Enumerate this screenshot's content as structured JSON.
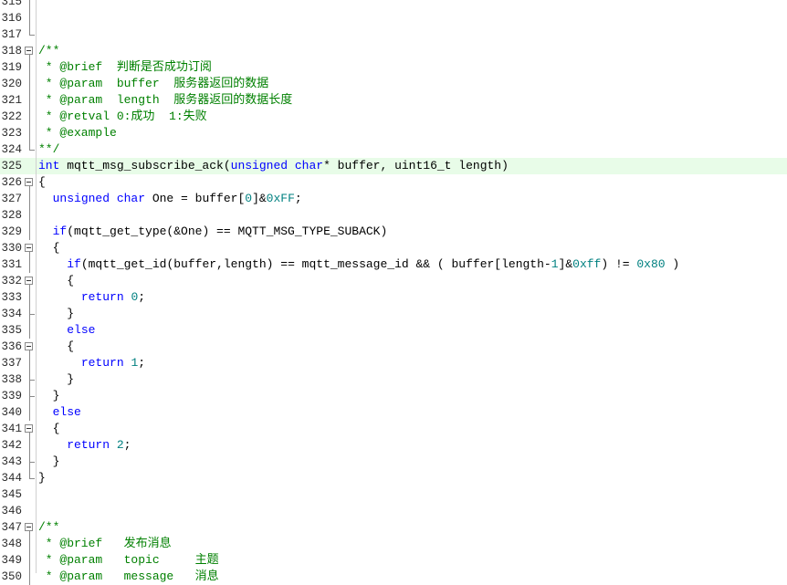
{
  "editor": {
    "highlight_line": "325",
    "lines": [
      {
        "n": "315",
        "fold": "line",
        "parts": []
      },
      {
        "n": "316",
        "fold": "line",
        "parts": []
      },
      {
        "n": "317",
        "fold": "end",
        "parts": []
      },
      {
        "n": "318",
        "fold": "box",
        "parts": [
          {
            "c": "cm",
            "t": "/**"
          }
        ]
      },
      {
        "n": "319",
        "fold": "line",
        "parts": [
          {
            "c": "cm",
            "t": " * @brief  判断是否成功订阅"
          }
        ]
      },
      {
        "n": "320",
        "fold": "line",
        "parts": [
          {
            "c": "cm",
            "t": " * @param  buffer  服务器返回的数据"
          }
        ]
      },
      {
        "n": "321",
        "fold": "line",
        "parts": [
          {
            "c": "cm",
            "t": " * @param  length  服务器返回的数据长度"
          }
        ]
      },
      {
        "n": "322",
        "fold": "line",
        "parts": [
          {
            "c": "cm",
            "t": " * @retval 0:成功  1:失败"
          }
        ]
      },
      {
        "n": "323",
        "fold": "line",
        "parts": [
          {
            "c": "cm",
            "t": " * @example"
          }
        ]
      },
      {
        "n": "324",
        "fold": "end",
        "parts": [
          {
            "c": "cm",
            "t": "**/"
          }
        ]
      },
      {
        "n": "325",
        "fold": "none",
        "parts": [
          {
            "c": "kw",
            "t": "int"
          },
          {
            "c": "",
            "t": " mqtt_msg_subscribe_ack("
          },
          {
            "c": "kw",
            "t": "unsigned char"
          },
          {
            "c": "",
            "t": "* buffer, uint16_t length)"
          }
        ]
      },
      {
        "n": "326",
        "fold": "box",
        "parts": [
          {
            "c": "",
            "t": "{"
          }
        ]
      },
      {
        "n": "327",
        "fold": "line",
        "parts": [
          {
            "c": "",
            "t": "  "
          },
          {
            "c": "kw",
            "t": "unsigned char"
          },
          {
            "c": "",
            "t": " One = buffer["
          },
          {
            "c": "nm",
            "t": "0"
          },
          {
            "c": "",
            "t": "]&"
          },
          {
            "c": "nm",
            "t": "0xFF"
          },
          {
            "c": "",
            "t": ";"
          }
        ]
      },
      {
        "n": "328",
        "fold": "line",
        "parts": []
      },
      {
        "n": "329",
        "fold": "line",
        "parts": [
          {
            "c": "",
            "t": "  "
          },
          {
            "c": "kw",
            "t": "if"
          },
          {
            "c": "",
            "t": "(mqtt_get_type(&One) == MQTT_MSG_TYPE_SUBACK)"
          }
        ]
      },
      {
        "n": "330",
        "fold": "box",
        "parts": [
          {
            "c": "",
            "t": "  {"
          }
        ]
      },
      {
        "n": "331",
        "fold": "line",
        "parts": [
          {
            "c": "",
            "t": "    "
          },
          {
            "c": "kw",
            "t": "if"
          },
          {
            "c": "",
            "t": "(mqtt_get_id(buffer,length) == mqtt_message_id && ( buffer[length-"
          },
          {
            "c": "nm",
            "t": "1"
          },
          {
            "c": "",
            "t": "]&"
          },
          {
            "c": "nm",
            "t": "0xff"
          },
          {
            "c": "",
            "t": ") != "
          },
          {
            "c": "nm",
            "t": "0x80"
          },
          {
            "c": "",
            "t": " )"
          }
        ]
      },
      {
        "n": "332",
        "fold": "box",
        "parts": [
          {
            "c": "",
            "t": "    {"
          }
        ]
      },
      {
        "n": "333",
        "fold": "line",
        "parts": [
          {
            "c": "",
            "t": "      "
          },
          {
            "c": "kw",
            "t": "return"
          },
          {
            "c": "",
            "t": " "
          },
          {
            "c": "nm",
            "t": "0"
          },
          {
            "c": "",
            "t": ";"
          }
        ]
      },
      {
        "n": "334",
        "fold": "tick",
        "parts": [
          {
            "c": "",
            "t": "    }"
          }
        ]
      },
      {
        "n": "335",
        "fold": "line",
        "parts": [
          {
            "c": "",
            "t": "    "
          },
          {
            "c": "kw",
            "t": "else"
          }
        ]
      },
      {
        "n": "336",
        "fold": "box",
        "parts": [
          {
            "c": "",
            "t": "    {"
          }
        ]
      },
      {
        "n": "337",
        "fold": "line",
        "parts": [
          {
            "c": "",
            "t": "      "
          },
          {
            "c": "kw",
            "t": "return"
          },
          {
            "c": "",
            "t": " "
          },
          {
            "c": "nm",
            "t": "1"
          },
          {
            "c": "",
            "t": ";"
          }
        ]
      },
      {
        "n": "338",
        "fold": "tick",
        "parts": [
          {
            "c": "",
            "t": "    }"
          }
        ]
      },
      {
        "n": "339",
        "fold": "tick",
        "parts": [
          {
            "c": "",
            "t": "  }"
          }
        ]
      },
      {
        "n": "340",
        "fold": "line",
        "parts": [
          {
            "c": "",
            "t": "  "
          },
          {
            "c": "kw",
            "t": "else"
          }
        ]
      },
      {
        "n": "341",
        "fold": "box",
        "parts": [
          {
            "c": "",
            "t": "  {"
          }
        ]
      },
      {
        "n": "342",
        "fold": "line",
        "parts": [
          {
            "c": "",
            "t": "    "
          },
          {
            "c": "kw",
            "t": "return"
          },
          {
            "c": "",
            "t": " "
          },
          {
            "c": "nm",
            "t": "2"
          },
          {
            "c": "",
            "t": ";"
          }
        ]
      },
      {
        "n": "343",
        "fold": "tick",
        "parts": [
          {
            "c": "",
            "t": "  }"
          }
        ]
      },
      {
        "n": "344",
        "fold": "end",
        "parts": [
          {
            "c": "",
            "t": "}"
          }
        ]
      },
      {
        "n": "345",
        "fold": "none",
        "parts": []
      },
      {
        "n": "346",
        "fold": "none",
        "parts": []
      },
      {
        "n": "347",
        "fold": "box",
        "parts": [
          {
            "c": "cm",
            "t": "/**"
          }
        ]
      },
      {
        "n": "348",
        "fold": "line",
        "parts": [
          {
            "c": "cm",
            "t": " * @brief   发布消息"
          }
        ]
      },
      {
        "n": "349",
        "fold": "line",
        "parts": [
          {
            "c": "cm",
            "t": " * @param   topic     主题"
          }
        ]
      },
      {
        "n": "350",
        "fold": "line",
        "parts": [
          {
            "c": "cm",
            "t": " * @param   message   消息"
          }
        ]
      }
    ]
  }
}
